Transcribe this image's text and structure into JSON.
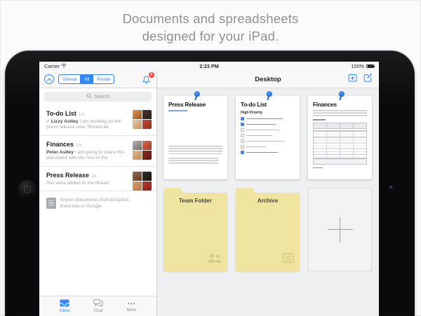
{
  "caption": {
    "line1": "Documents and spreadsheets",
    "line2": "designed for your iPad."
  },
  "statusbar": {
    "carrier": "Carrier",
    "time": "2:23 PM",
    "battery": "100%"
  },
  "icons": {
    "more_glyph": "•••"
  },
  "sidebar": {
    "segmented": {
      "unread": "Unread",
      "all": "All",
      "private": "Private"
    },
    "badge": "6",
    "search_placeholder": "Search",
    "items": [
      {
        "title": "To-do List",
        "time": "1m",
        "check": "✓",
        "sender": "Lizzy Astley",
        "preview": " I am working on the press release now. Should be"
      },
      {
        "title": "Finances",
        "time": "1m",
        "check": "",
        "sender": "Peter Astley",
        "preview": " I am going to share this document with the rest of the"
      },
      {
        "title": "Press Release",
        "time": "1h",
        "check": "",
        "sender": "",
        "preview": "You were added to the thread"
      }
    ],
    "import_text": "Import documents from Dropbox, Evernote or Google",
    "tabs": [
      {
        "label": "Inbox"
      },
      {
        "label": "Chat"
      },
      {
        "label": "More"
      }
    ]
  },
  "main": {
    "title": "Desktop",
    "cards": [
      {
        "title": "Press Release"
      },
      {
        "title": "To-do List",
        "subheading": "High Priority"
      },
      {
        "title": "Finances"
      }
    ],
    "folders": [
      {
        "name": "Team Folder"
      },
      {
        "name": "Archive"
      }
    ]
  },
  "colors": {
    "accent": "#3187f6",
    "badge": "#fc3d39",
    "folder": "#efe5a0"
  }
}
